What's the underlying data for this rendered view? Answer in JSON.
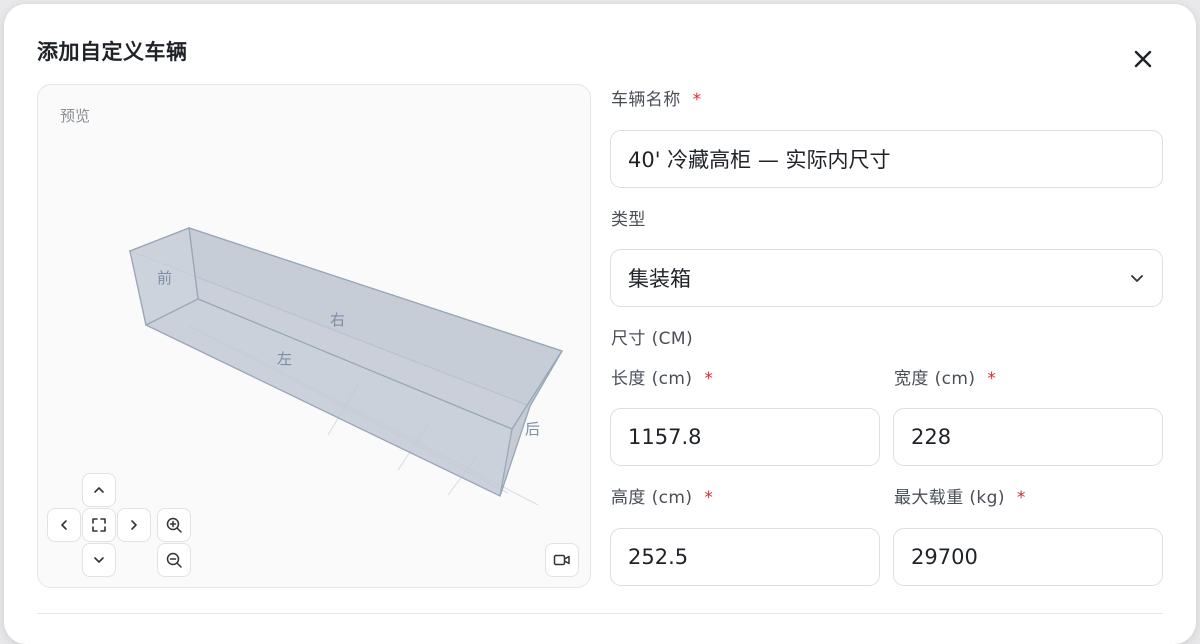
{
  "dialog": {
    "title": "添加自定义车辆"
  },
  "preview": {
    "label": "预览",
    "faces": {
      "front": "前",
      "right": "右",
      "left": "左",
      "back": "后"
    }
  },
  "form": {
    "name": {
      "label": "车辆名称",
      "required_mark": "*",
      "value": "40' 冷藏高柜 — 实际内尺寸"
    },
    "type": {
      "label": "类型",
      "value": "集装箱"
    },
    "dimensions_heading": "尺寸 (CM)",
    "length": {
      "label": "长度 (cm)",
      "required_mark": "*",
      "value": "1157.8"
    },
    "width": {
      "label": "宽度 (cm)",
      "required_mark": "*",
      "value": "228"
    },
    "height": {
      "label": "高度 (cm)",
      "required_mark": "*",
      "value": "252.5"
    },
    "max_load": {
      "label": "最大载重 (kg)",
      "required_mark": "*",
      "value": "29700"
    }
  }
}
